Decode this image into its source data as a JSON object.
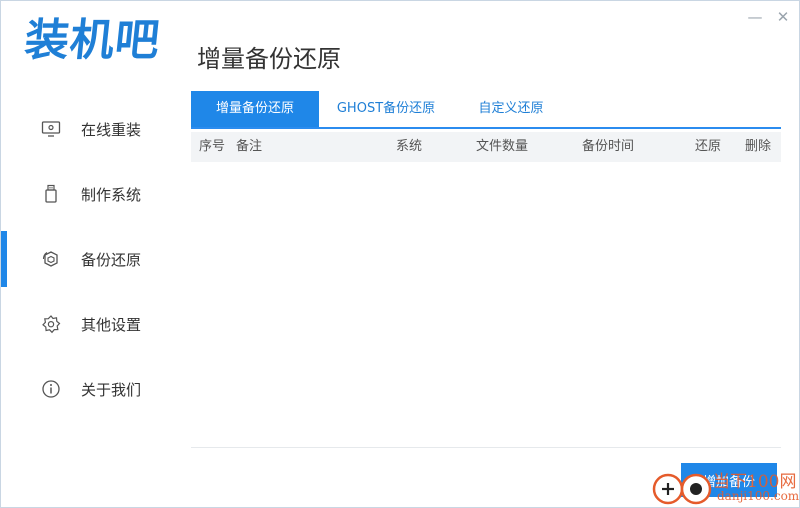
{
  "app": {
    "logo_text": "装机吧"
  },
  "window_controls": {
    "minimize": "—",
    "close": "✕"
  },
  "sidebar": {
    "items": [
      {
        "label": "在线重装",
        "icon": "monitor-icon"
      },
      {
        "label": "制作系统",
        "icon": "usb-drive-icon"
      },
      {
        "label": "备份还原",
        "icon": "backup-restore-icon",
        "active": true
      },
      {
        "label": "其他设置",
        "icon": "gear-icon"
      },
      {
        "label": "关于我们",
        "icon": "info-icon"
      }
    ]
  },
  "main": {
    "title": "增量备份还原",
    "tabs": [
      {
        "label": "增量备份还原",
        "active": true
      },
      {
        "label": "GHOST备份还原",
        "active": false
      },
      {
        "label": "自定义还原",
        "active": false
      }
    ],
    "table": {
      "columns": [
        "序号",
        "备注",
        "系统",
        "文件数量",
        "备份时间",
        "还原",
        "删除"
      ],
      "rows": []
    },
    "add_backup_button": "增加备份"
  },
  "watermark": {
    "line1": "当下100网",
    "line2": "danji100.com"
  },
  "colors": {
    "accent": "#1f87e8",
    "logo": "#1f7fd6",
    "header_bg": "#f2f4f6"
  }
}
